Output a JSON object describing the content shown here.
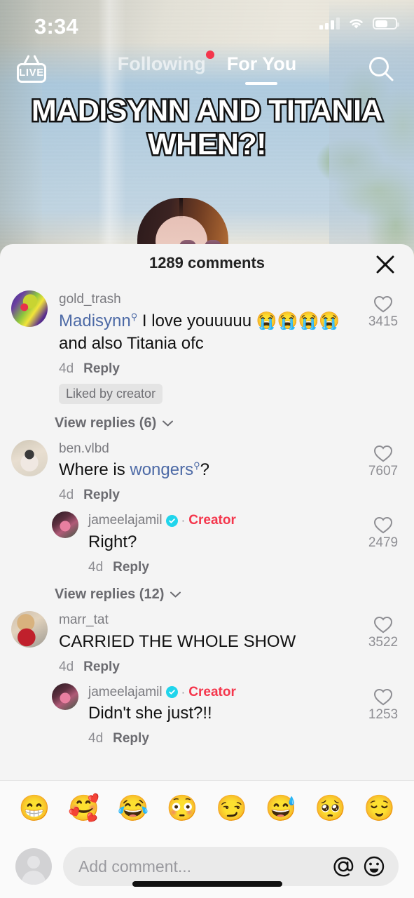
{
  "status_bar": {
    "time": "3:34",
    "battery_percent": 55
  },
  "top_nav": {
    "live_label": "LIVE",
    "tabs": [
      {
        "label": "Following",
        "active": false,
        "has_dot": true
      },
      {
        "label": "For You",
        "active": true,
        "has_dot": false
      }
    ],
    "search_icon": "search-icon"
  },
  "video": {
    "caption": "MADISYNN AND TITANIA WHEN?!"
  },
  "sheet": {
    "title": "1289 comments",
    "close_icon": "close-icon"
  },
  "comments": [
    {
      "username": "gold_trash",
      "verified": false,
      "creator": false,
      "text_prefix": "",
      "mention": "Madisynn",
      "text_after": " I love youuuuu ",
      "emojis": "😭😭😭😭",
      "text_tail": " and also Titania ofc",
      "time": "4d",
      "reply_label": "Reply",
      "liked_by_creator": "Liked by creator",
      "likes": "3415",
      "view_replies": "View replies (6)"
    },
    {
      "username": "ben.vlbd",
      "verified": false,
      "creator": false,
      "text_prefix": "Where is ",
      "mention": "wongers",
      "text_after": "?",
      "emojis": "",
      "text_tail": "",
      "time": "4d",
      "reply_label": "Reply",
      "likes": "7607",
      "reply": {
        "username": "jameelajamil",
        "verified": true,
        "creator_label": "Creator",
        "text": "Right?",
        "time": "4d",
        "reply_label": "Reply",
        "likes": "2479"
      },
      "view_replies": "View replies (12)"
    },
    {
      "username": "marr_tat",
      "verified": false,
      "creator": false,
      "text_prefix": "CARRIED THE WHOLE SHOW",
      "mention": "",
      "text_after": "",
      "emojis": "",
      "text_tail": "",
      "time": "4d",
      "reply_label": "Reply",
      "likes": "3522",
      "reply": {
        "username": "jameelajamil",
        "verified": true,
        "creator_label": "Creator",
        "text": "Didn't she just?!!",
        "time": "4d",
        "reply_label": "Reply",
        "likes": "1253"
      }
    }
  ],
  "emoji_bar": [
    "😁",
    "🥰",
    "😂",
    "😳",
    "😏",
    "😅",
    "🥺",
    "😌"
  ],
  "input_bar": {
    "placeholder": "Add comment...",
    "mention_icon": "at-mention-icon",
    "sticker_icon": "emoji-sticker-icon"
  },
  "colors": {
    "accent_red": "#f4364c",
    "verified_blue": "#20d5ec",
    "mention_blue": "#4d6aa6",
    "sheet_bg": "#f4f4f4"
  }
}
